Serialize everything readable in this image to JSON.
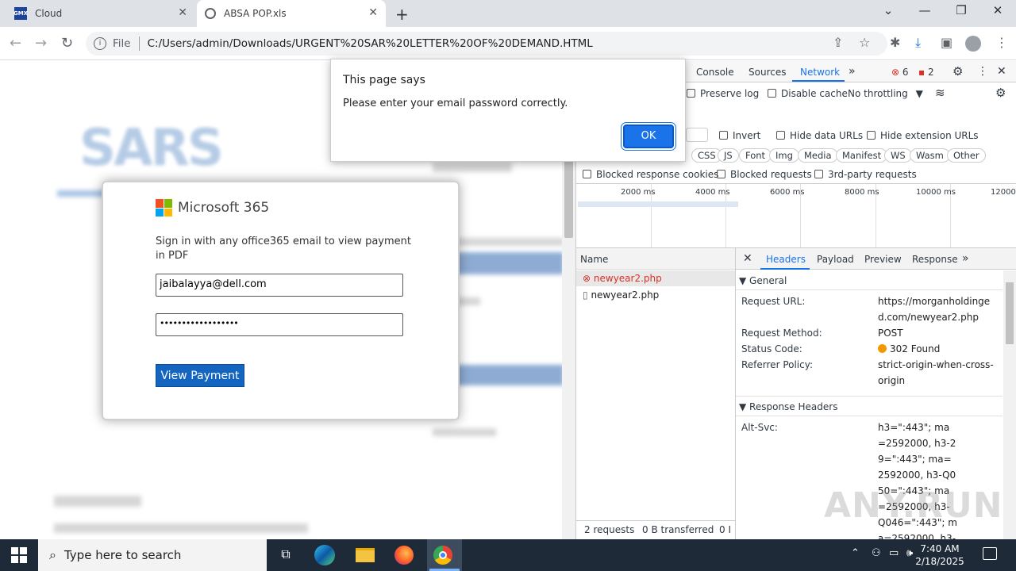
{
  "browser": {
    "tabs": [
      {
        "title": "Cloud",
        "favicon": "GMX"
      },
      {
        "title": "ABSA POP.xls"
      }
    ],
    "address": {
      "scheme_label": "File",
      "url": "C:/Users/admin/Downloads/URGENT%20SAR%20LETTER%20OF%20DEMAND.HTML"
    }
  },
  "page": {
    "brand": "SARS",
    "modal": {
      "logo_text": "Microsoft 365",
      "description": "Sign in with any office365 email to view payment in PDF",
      "email_value": "jaibalayya@dell.com",
      "password_value": "••••••••••••••••••",
      "button_label": "View Payment"
    }
  },
  "alert": {
    "title": "This page says",
    "message": "Please enter your email password correctly.",
    "ok_label": "OK"
  },
  "devtools": {
    "tabs": {
      "console": "Console",
      "sources": "Sources",
      "network": "Network",
      "more": "»"
    },
    "errors": "6",
    "warnings": "2",
    "toolbar": {
      "preserve_log": "Preserve log",
      "disable_cache": "Disable cache",
      "throttling": "No throttling"
    },
    "filters": {
      "invert": "Invert",
      "hide_data": "Hide data URLs",
      "hide_ext": "Hide extension URLs"
    },
    "types": [
      "CSS",
      "JS",
      "Font",
      "Img",
      "Media",
      "Manifest",
      "WS",
      "Wasm",
      "Other"
    ],
    "blocked": {
      "cookies": "Blocked response cookies",
      "requests": "Blocked requests",
      "third_party": "3rd-party requests"
    },
    "timeline_ticks": [
      "2000 ms",
      "4000 ms",
      "6000 ms",
      "8000 ms",
      "10000 ms",
      "12000"
    ],
    "requests_header": "Name",
    "requests": [
      {
        "name": "newyear2.php",
        "status": "error"
      },
      {
        "name": "newyear2.php",
        "status": "ok"
      }
    ],
    "summary": {
      "count": "2 requests",
      "transferred": "0 B transferred",
      "extra": "0 I"
    },
    "detail_tabs": [
      "Headers",
      "Payload",
      "Preview",
      "Response",
      "»"
    ],
    "general": {
      "section": "General",
      "url_label": "Request URL:",
      "url_value": "https://morganholdinged.com/newyear2.php",
      "method_label": "Request Method:",
      "method_value": "POST",
      "status_label": "Status Code:",
      "status_value": "302 Found",
      "referrer_label": "Referrer Policy:",
      "referrer_value": "strict-origin-when-cross-origin"
    },
    "response_headers": {
      "section": "Response Headers",
      "altsvc_label": "Alt-Svc:",
      "altsvc_value": "h3=\":443\"; ma=2592000, h3-29=\":443\"; ma=2592000, h3-Q050=\":443\"; ma=2592000, h3-Q046=\":443\"; ma=2592000, h3-"
    }
  },
  "taskbar": {
    "search_placeholder": "Type here to search",
    "time": "7:40 AM",
    "date": "2/18/2025"
  },
  "watermark": "ANY.RUN",
  "colors": {
    "accent": "#1a73e8",
    "error": "#d93025",
    "network_tab": "#1a73e8",
    "ms_button": "#1465c0"
  }
}
